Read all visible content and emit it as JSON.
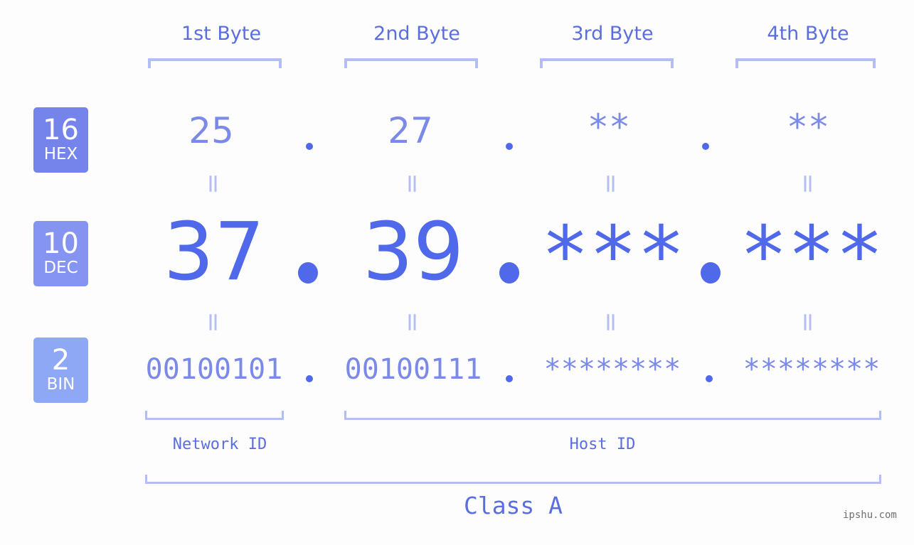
{
  "bytes": {
    "headers": [
      "1st Byte",
      "2nd Byte",
      "3rd Byte",
      "4th Byte"
    ]
  },
  "rows": {
    "hex": {
      "base": "16",
      "label": "HEX",
      "values": [
        "25",
        "27",
        "**",
        "**"
      ]
    },
    "dec": {
      "base": "10",
      "label": "DEC",
      "values": [
        "37",
        "39",
        "***",
        "***"
      ]
    },
    "bin": {
      "base": "2",
      "label": "BIN",
      "values": [
        "00100101",
        "00100111",
        "********",
        "********"
      ]
    }
  },
  "equals_symbol": "=",
  "sections": {
    "network_id": "Network ID",
    "host_id": "Host ID",
    "class": "Class A"
  },
  "watermark": "ipshu.com",
  "colors": {
    "hex_badge": "#7584ea",
    "dec_badge": "#8494f0",
    "bin_badge": "#8fa8f6",
    "accent": "#5068ea",
    "bracket": "#b4bdf5"
  }
}
